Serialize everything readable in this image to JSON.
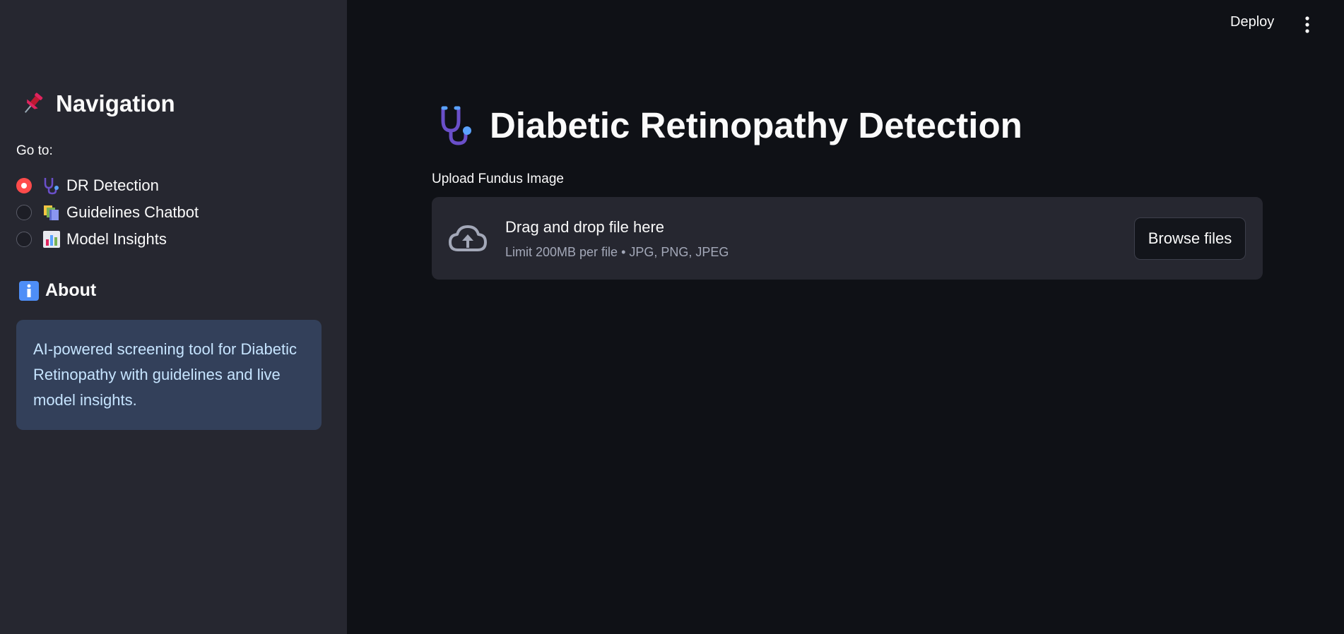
{
  "header": {
    "deploy_label": "Deploy",
    "menu_icon": "vertical-ellipsis-icon"
  },
  "sidebar": {
    "title": "Navigation",
    "title_icon": "pushpin-icon",
    "goto_label": "Go to:",
    "options": [
      {
        "label": "DR Detection",
        "icon": "stethoscope-icon",
        "selected": true
      },
      {
        "label": "Guidelines Chatbot",
        "icon": "books-icon",
        "selected": false
      },
      {
        "label": "Model Insights",
        "icon": "bar-chart-icon",
        "selected": false
      }
    ],
    "about_title": "About",
    "about_icon": "information-icon",
    "about_lines": [
      "AI-powered screening tool for Diabetic",
      "Retinopathy with guidelines and live",
      "model insights."
    ]
  },
  "main": {
    "title": "Diabetic Retinopathy Detection",
    "title_icon": "stethoscope-icon",
    "upload_label": "Upload Fundus Image",
    "dropzone": {
      "title": "Drag and drop file here",
      "limit": "Limit 200MB per file • JPG, PNG, JPEG",
      "icon": "cloud-upload-icon",
      "button_label": "Browse files"
    }
  },
  "colors": {
    "sidebar_bg": "#262730",
    "main_bg": "#0f1116",
    "accent": "#ff4b4b",
    "info_bg": "#33405a",
    "info_text": "#c6e4ff"
  }
}
